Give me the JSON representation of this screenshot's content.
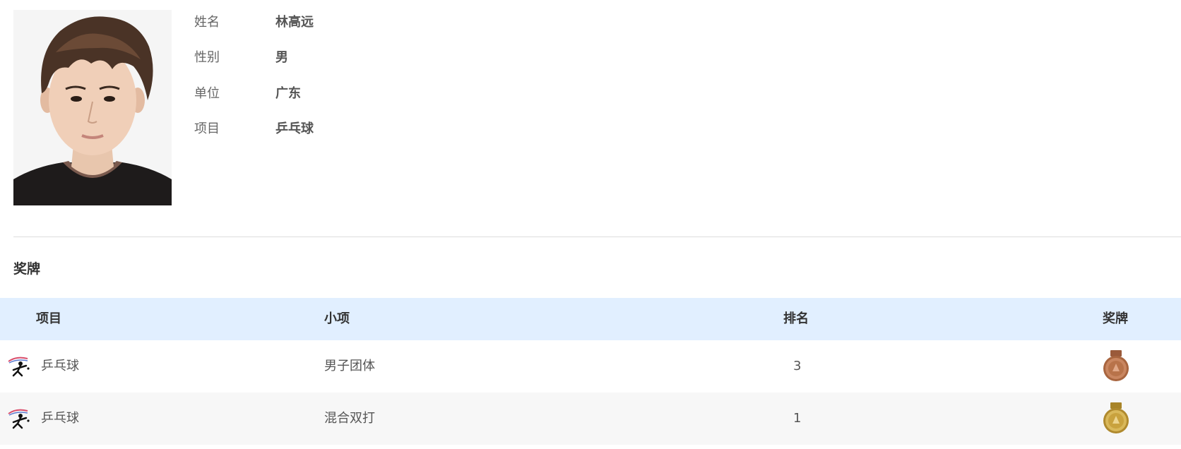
{
  "profile": {
    "photo_alt": "athlete-portrait",
    "fields": [
      {
        "label": "姓名",
        "value": "林高远"
      },
      {
        "label": "性别",
        "value": "男"
      },
      {
        "label": "单位",
        "value": "广东"
      },
      {
        "label": "项目",
        "value": "乒乓球"
      }
    ]
  },
  "medals": {
    "title": "奖牌",
    "columns": {
      "sport": "项目",
      "event": "小项",
      "rank": "排名",
      "medal": "奖牌"
    },
    "rows": [
      {
        "sport": "乒乓球",
        "sport_icon": "table-tennis-icon",
        "event": "男子团体",
        "rank": "3",
        "medal": "bronze",
        "medal_color": "#b8734a"
      },
      {
        "sport": "乒乓球",
        "sport_icon": "table-tennis-icon",
        "event": "混合双打",
        "rank": "1",
        "medal": "gold",
        "medal_color": "#c9a23e"
      }
    ]
  },
  "colors": {
    "header_bg": "#e1efff",
    "divider": "#dddddd",
    "row_alt_bg": "#f7f7f7"
  }
}
